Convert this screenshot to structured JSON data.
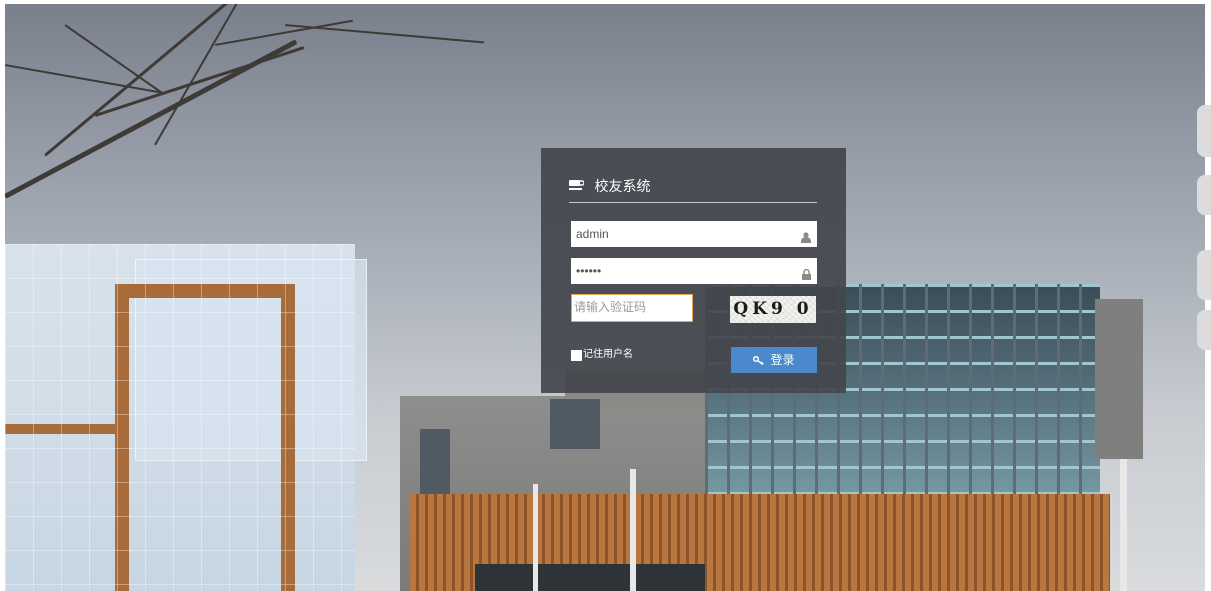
{
  "login": {
    "title": "校友系统",
    "username_value": "admin",
    "password_value": "••••••",
    "captcha_placeholder": "请输入验证码",
    "captcha_text": "QK9 0",
    "remember_label": "记住用户名",
    "login_label": "登录"
  },
  "icons": {
    "title_icon": "coffee-cup-icon",
    "username_icon": "user-icon",
    "password_icon": "lock-icon",
    "login_icon": "key-icon"
  },
  "colors": {
    "panel_bg": "#43454c",
    "button_bg": "#4a89cc",
    "captcha_border": "#e8a35a"
  }
}
